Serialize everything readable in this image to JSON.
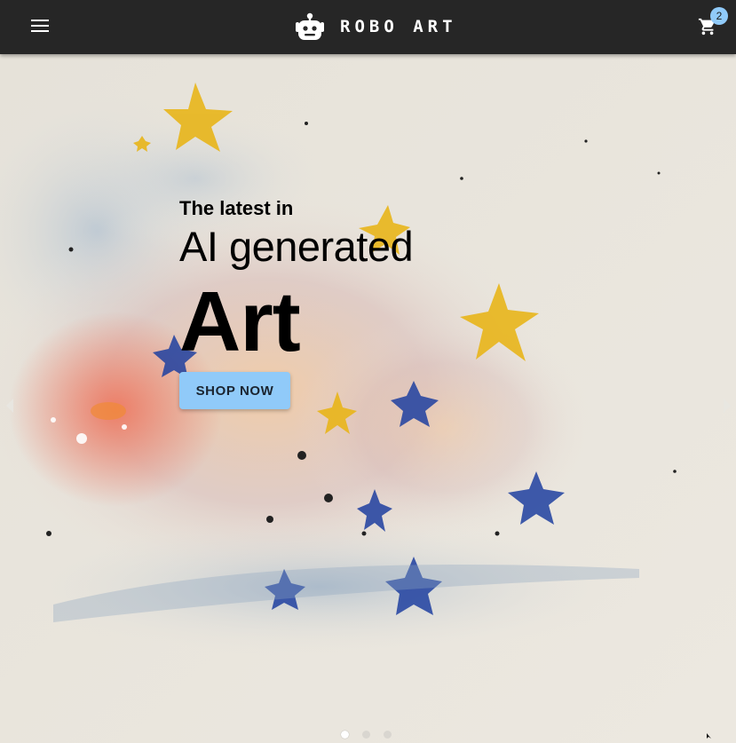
{
  "appbar": {
    "brand_text": "ROBO ART",
    "cart_count": "2",
    "menu_icon": "menu-icon",
    "logo_icon": "robot-icon",
    "cart_icon": "shopping-cart-icon"
  },
  "hero": {
    "eyebrow": "The latest in",
    "subhead": "AI generated",
    "headline": "Art",
    "cta_label": "SHOP NOW",
    "prev_icon": "chevron-left-icon",
    "next_icon": "chevron-right-icon",
    "slide_count": 3,
    "active_slide": 1
  },
  "colors": {
    "appbar_bg": "#262626",
    "accent": "#90caf9",
    "text": "#000000"
  }
}
